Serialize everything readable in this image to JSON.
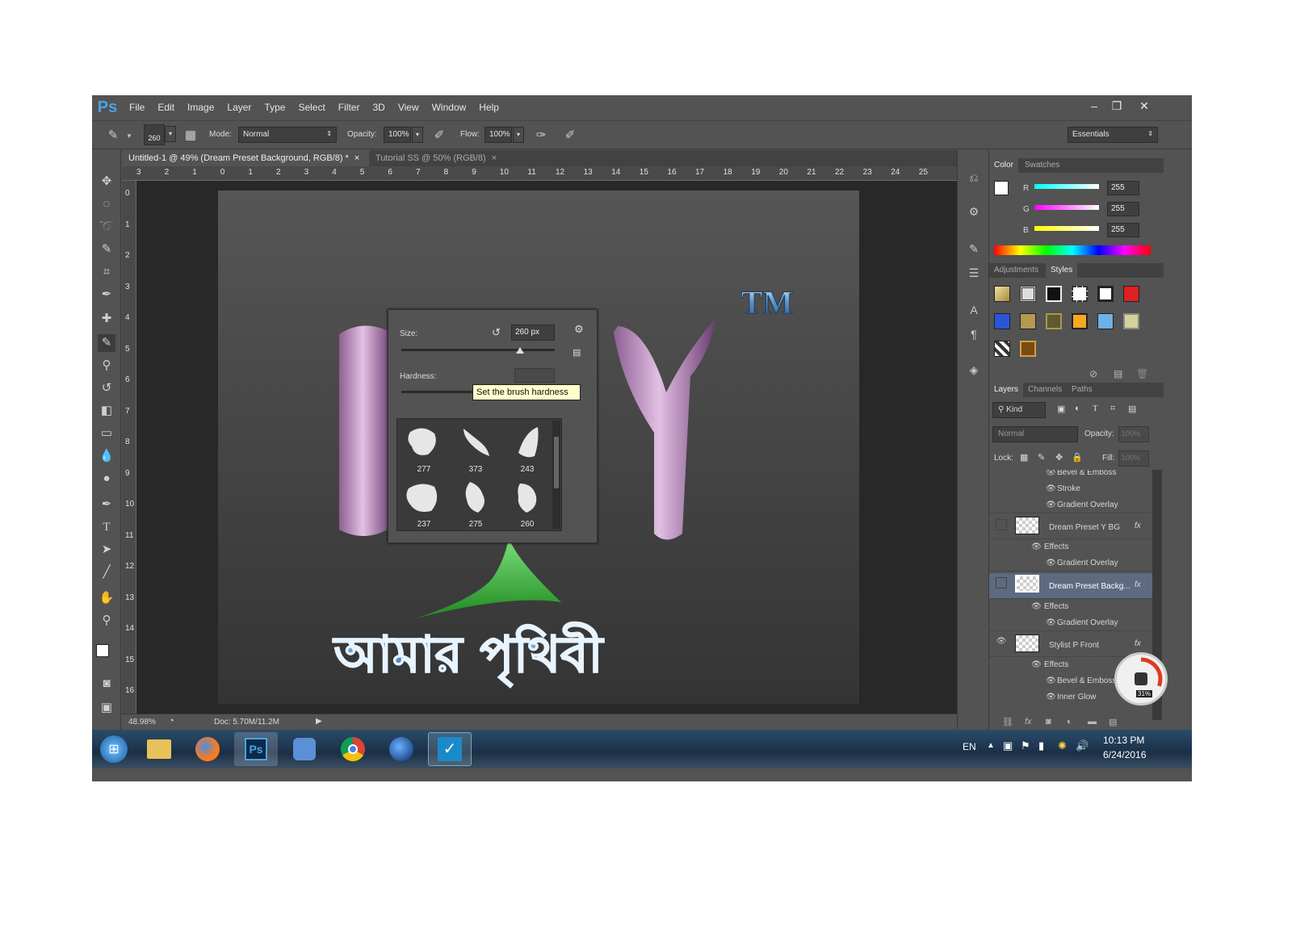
{
  "app": {
    "logo": "Ps"
  },
  "menu": [
    "File",
    "Edit",
    "Image",
    "Layer",
    "Type",
    "Select",
    "Filter",
    "3D",
    "View",
    "Window",
    "Help"
  ],
  "window_controls": {
    "minimize": "–",
    "restore": "❐",
    "close": "✕"
  },
  "options": {
    "brush_size": "260",
    "mode_label": "Mode:",
    "mode_value": "Normal",
    "opacity_label": "Opacity:",
    "opacity_value": "100%",
    "flow_label": "Flow:",
    "flow_value": "100%",
    "workspace": "Essentials"
  },
  "tabs": [
    {
      "label": "Untitled-1 @ 49% (Dream Preset Background, RGB/8) *",
      "active": true
    },
    {
      "label": "Tutorial SS @ 50% (RGB/8)",
      "active": false
    }
  ],
  "ruler_h": [
    "3",
    "2",
    "1",
    "0",
    "1",
    "2",
    "3",
    "4",
    "5",
    "6",
    "7",
    "8",
    "9",
    "10",
    "11",
    "12",
    "13",
    "14",
    "15",
    "16",
    "17",
    "18",
    "19",
    "20",
    "21",
    "22",
    "23",
    "24",
    "25"
  ],
  "ruler_v": [
    "0",
    "1",
    "2",
    "3",
    "4",
    "5",
    "6",
    "7",
    "8",
    "9",
    "10",
    "11",
    "12",
    "13",
    "14",
    "15",
    "16"
  ],
  "canvas": {
    "tm_text": "TM",
    "bengali_text": "আমার পৃথিবী"
  },
  "brush_popup": {
    "size_label": "Size:",
    "size_value": "260 px",
    "hardness_label": "Hardness:",
    "tooltip": "Set the brush hardness",
    "presets": [
      "277",
      "373",
      "243",
      "237",
      "275",
      "260"
    ]
  },
  "status": {
    "zoom": "48.98%",
    "doc": "Doc: 5.70M/11.2M"
  },
  "color_panel": {
    "tabs": [
      "Color",
      "Swatches"
    ],
    "channels": [
      {
        "name": "R",
        "value": "255"
      },
      {
        "name": "G",
        "value": "255"
      },
      {
        "name": "B",
        "value": "255"
      }
    ]
  },
  "styles_panel": {
    "tabs": [
      "Adjustments",
      "Styles"
    ]
  },
  "layers_panel": {
    "tabs": [
      "Layers",
      "Channels",
      "Paths"
    ],
    "kind": "Kind",
    "blend": "Normal",
    "opacity_label": "Opacity:",
    "opacity_value": "100%",
    "lock_label": "Lock:",
    "fill_label": "Fill:",
    "fill_value": "100%",
    "items": [
      {
        "type": "fx",
        "label": "Bevel & Emboss"
      },
      {
        "type": "fx",
        "label": "Stroke"
      },
      {
        "type": "fx",
        "label": "Gradient Overlay"
      },
      {
        "type": "layer",
        "label": "Dream Preset Y BG"
      },
      {
        "type": "effects",
        "label": "Effects"
      },
      {
        "type": "fx",
        "label": "Gradient Overlay"
      },
      {
        "type": "layer",
        "label": "Dream Preset Backg..."
      },
      {
        "type": "effects",
        "label": "Effects"
      },
      {
        "type": "fx",
        "label": "Gradient Overlay"
      },
      {
        "type": "layer",
        "label": "Stylist P Front"
      },
      {
        "type": "effects",
        "label": "Effects"
      },
      {
        "type": "fx",
        "label": "Bevel & Emboss"
      },
      {
        "type": "fx",
        "label": "Inner Glow"
      }
    ],
    "fx_badge": "fx"
  },
  "gauge": {
    "percent": 0.31,
    "label": "31%"
  },
  "taskbar": {
    "lang": "EN",
    "time": "10:13 PM",
    "date": "6/24/2016"
  }
}
